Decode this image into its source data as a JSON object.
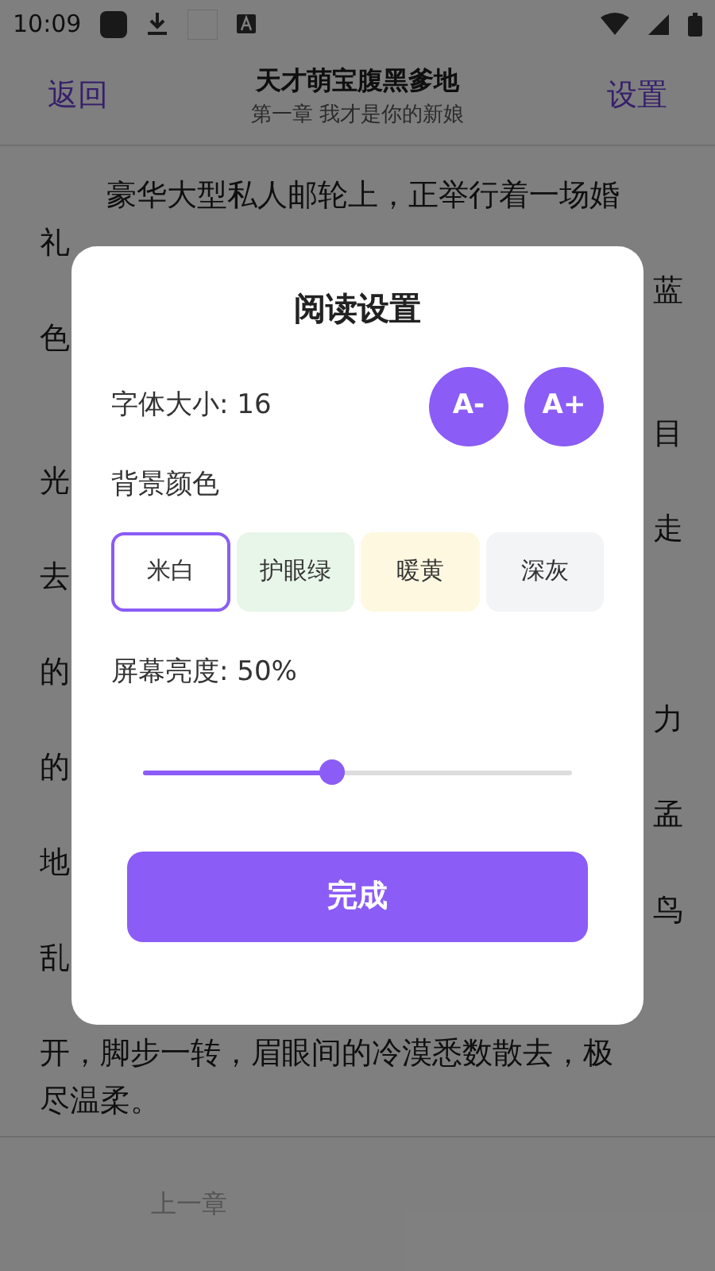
{
  "status_bar": {
    "time": "10:09"
  },
  "header": {
    "back": "返回",
    "title": "天才萌宝腹黑爹地",
    "subtitle": "第一章 我才是你的新娘",
    "settings": "设置"
  },
  "body": {
    "opening_line": "豪华大型私人邮轮上，正举行着一场婚",
    "lines": [
      {
        "kind": "left",
        "text": "礼"
      },
      {
        "kind": "right",
        "text": "蓝"
      },
      {
        "kind": "left",
        "text": "色"
      },
      {
        "kind": "blank"
      },
      {
        "kind": "right",
        "text": "目"
      },
      {
        "kind": "left",
        "text": "光"
      },
      {
        "kind": "right",
        "text": "走"
      },
      {
        "kind": "left",
        "text": "去"
      },
      {
        "kind": "blank"
      },
      {
        "kind": "left",
        "text": "的"
      },
      {
        "kind": "right",
        "text": "力"
      },
      {
        "kind": "left",
        "text": "的"
      },
      {
        "kind": "right",
        "text": "孟"
      },
      {
        "kind": "left",
        "text": "地"
      },
      {
        "kind": "right",
        "text": "鸟"
      },
      {
        "kind": "left",
        "text": "乱"
      },
      {
        "kind": "blank"
      },
      {
        "kind": "left",
        "text": "开，脚步一转，眉眼间的冷漠悉数散去，极"
      },
      {
        "kind": "left",
        "text": "尽温柔。"
      }
    ]
  },
  "footer": {
    "prev": "上一章"
  },
  "dialog": {
    "title": "阅读设置",
    "font_size_label": "字体大小: 16",
    "font_buttons": [
      "A-",
      "A+"
    ],
    "background_label": "背景颜色",
    "backgrounds": [
      {
        "label": "米白",
        "color": "#ffffff",
        "selected": true
      },
      {
        "label": "护眼绿",
        "color": "#e8f5e9",
        "selected": false
      },
      {
        "label": "暖黄",
        "color": "#fff8e1",
        "selected": false
      },
      {
        "label": "深灰",
        "color": "#f3f4f6",
        "selected": false
      }
    ],
    "brightness_label": "屏幕亮度: 50%",
    "brightness": {
      "level": 0.44
    },
    "done": "完成"
  }
}
